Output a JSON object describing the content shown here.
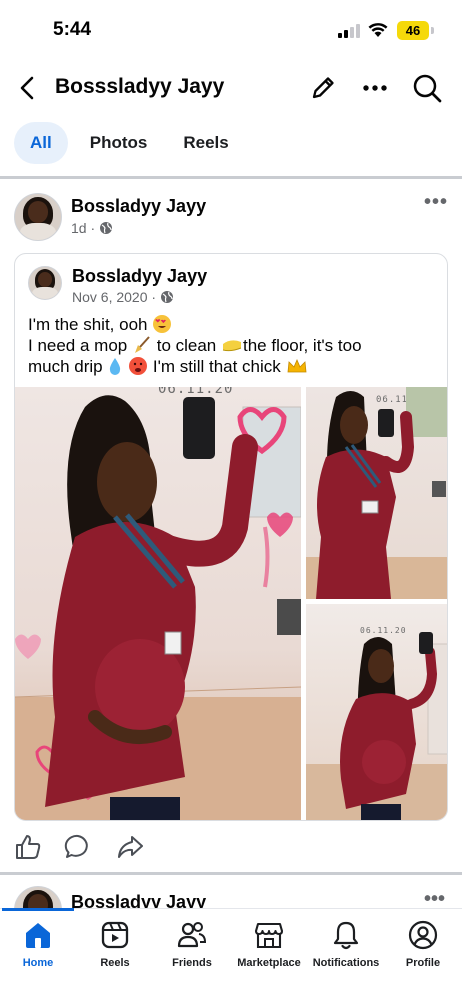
{
  "status_bar": {
    "time": "5:44",
    "battery": "46"
  },
  "header": {
    "title": "Bosssladyy Jayy"
  },
  "tabs": [
    {
      "label": "All",
      "active": true
    },
    {
      "label": "Photos",
      "active": false
    },
    {
      "label": "Reels",
      "active": false
    }
  ],
  "post": {
    "author": "Bossladyy Jayy",
    "time": "1d",
    "more": "•••",
    "shared": {
      "author": "Bossladyy Jayy",
      "date": "Nov 6, 2020",
      "caption_line1": "I'm the shit, ooh",
      "caption_line2a": "I need a mop",
      "caption_line2b": "to clean",
      "caption_line2c": "the floor, it's too",
      "caption_line3a": "much drip",
      "caption_line3b": "I'm still that chick",
      "photo_stamp": "06.11.20"
    }
  },
  "next_post": {
    "author": "Bossladyy Jayy",
    "more": "•••"
  },
  "bottom_nav": [
    {
      "label": "Home",
      "icon": "home-icon",
      "active": true
    },
    {
      "label": "Reels",
      "icon": "reels-icon",
      "active": false
    },
    {
      "label": "Friends",
      "icon": "friends-icon",
      "active": false
    },
    {
      "label": "Marketplace",
      "icon": "marketplace-icon",
      "active": false
    },
    {
      "label": "Notifications",
      "icon": "bell-icon",
      "active": false
    },
    {
      "label": "Profile",
      "icon": "profile-icon",
      "active": false
    }
  ],
  "colors": {
    "accent": "#0a66d8",
    "tab_active_bg": "#e7f0fb",
    "battery": "#f5d90a",
    "muted": "#65676b"
  }
}
